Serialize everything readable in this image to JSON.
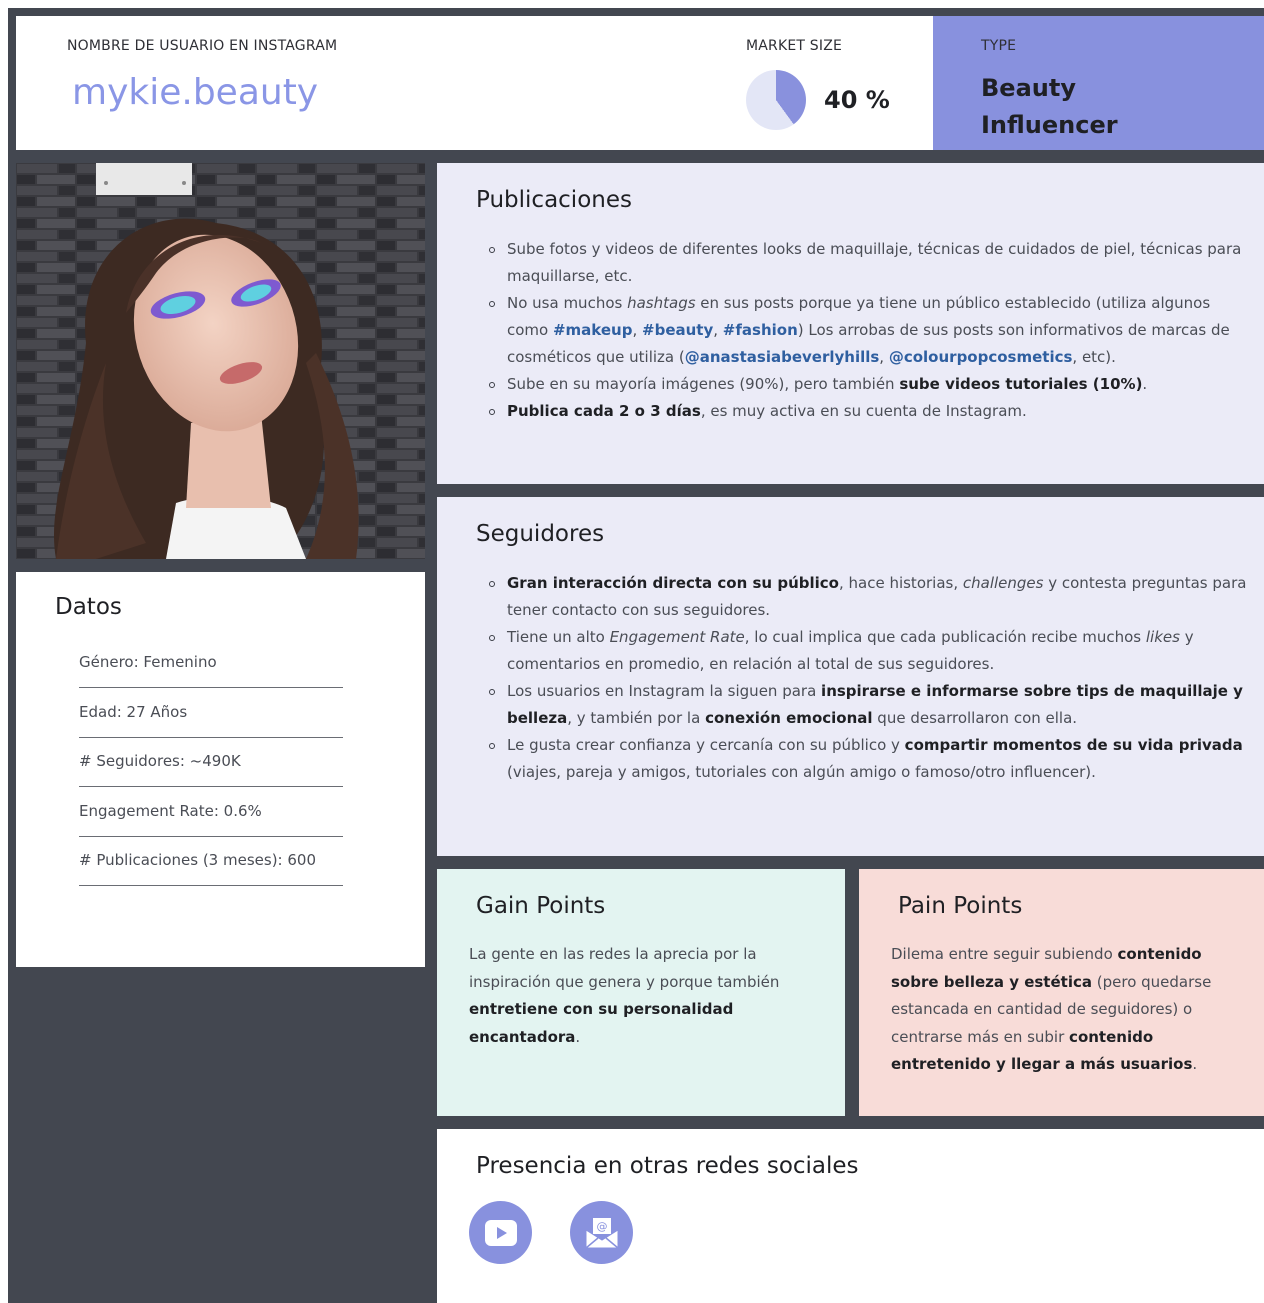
{
  "header": {
    "username_label": "NOMBRE DE USUARIO EN INSTAGRAM",
    "username": "mykie.beauty",
    "market_size_label": "MARKET SIZE",
    "market_size_value": "40 %",
    "market_size_fraction": 0.4,
    "type_label": "TYPE",
    "type_value": "Beauty Influencer"
  },
  "colors": {
    "accent": "#8891de",
    "dark_bg": "#434750",
    "section_bg": "#ebebf7",
    "gain_bg": "#e3f4f1",
    "pain_bg": "#f8dcd8",
    "hashtag": "#2f5fa0"
  },
  "datos": {
    "title": "Datos",
    "items": [
      "Género: Femenino",
      "Edad: 27 Años",
      "# Seguidores: ~490K",
      "Engagement Rate: 0.6%",
      "# Publicaciones (3 meses): 600"
    ]
  },
  "publicaciones": {
    "title": "Publicaciones",
    "b1": "Sube fotos y videos de diferentes looks de maquillaje, técnicas de cuidados de piel, técnicas para maquillarse, etc.",
    "b2_a": "No usa muchos ",
    "b2_b": "hashtags",
    "b2_c": " en sus posts porque ya tiene un público establecido (utiliza algunos como ",
    "b2_t1": "#makeup",
    "b2_sep1": ", ",
    "b2_t2": "#beauty",
    "b2_sep2": ", ",
    "b2_t3": "#fashion",
    "b2_d": ") Los arrobas de sus posts son informativos de marcas de cosméticos que utiliza (",
    "b2_t4": "@anastasiabeverlyhills",
    "b2_sep3": ", ",
    "b2_t5": "@colourpopcosmetics",
    "b2_e": ", etc).",
    "b3_a": "Sube en su mayoría imágenes (90%), pero también ",
    "b3_b": "sube videos tutoriales (10%)",
    "b3_c": ".",
    "b4_a": "Publica cada 2 o 3 días",
    "b4_b": ", es muy activa en su cuenta de Instagram."
  },
  "seguidores": {
    "title": "Seguidores",
    "b1_a": "Gran interacción directa con su público",
    "b1_b": ", hace historias, ",
    "b1_c": "challenges",
    "b1_d": " y contesta preguntas para tener contacto con sus seguidores.",
    "b2_a": "Tiene un alto ",
    "b2_b": "Engagement Rate",
    "b2_c": ", lo cual implica que cada publicación recibe muchos ",
    "b2_d": "likes",
    "b2_e": " y comentarios en promedio, en relación al total de sus seguidores.",
    "b3_a": "Los usuarios en Instagram la siguen para ",
    "b3_b": "inspirarse e informarse sobre tips de maquillaje y belleza",
    "b3_c": ", y también por la ",
    "b3_d": "conexión emocional",
    "b3_e": " que desarrollaron con ella.",
    "b4_a": "Le gusta crear confianza y cercanía con su público y ",
    "b4_b": "compartir momentos de su vida privada",
    "b4_c": " (viajes, pareja y amigos, tutoriales con algún amigo o famoso/otro influencer)."
  },
  "gain": {
    "title": "Gain Points",
    "text_a": " La gente en las redes la aprecia por la inspiración que genera y porque también ",
    "text_b": "entretiene con su personalidad encantadora",
    "text_c": "."
  },
  "pain": {
    "title": "Pain Points",
    "text_a": "Dilema entre seguir subiendo ",
    "text_b": "contenido sobre belleza y estética",
    "text_c": " (pero quedarse estancada en cantidad de seguidores) o centrarse más en subir ",
    "text_d": "contenido entretenido y llegar a más usuarios",
    "text_e": "."
  },
  "redes": {
    "title": "Presencia en otras redes sociales",
    "icons": [
      "youtube-icon",
      "email-newsletter-icon"
    ]
  }
}
